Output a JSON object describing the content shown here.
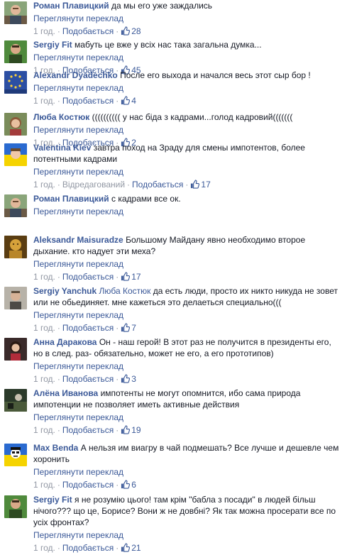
{
  "ui": {
    "translate_label": "Переглянути переклад",
    "like_label": "Подобається",
    "edited_label": "Відредагований",
    "separator": "·"
  },
  "comments": [
    {
      "author": "Роман Плавицкий",
      "text": "да мы его уже заждались",
      "time": "1 год.",
      "likes": "28",
      "avatar": "man-outdoor-photo"
    },
    {
      "author": "Sergiy Fit",
      "text": "мабуть це вже у всіх нас така загальна думка...",
      "time": "1 год.",
      "likes": "45",
      "avatar": "man-green-photo"
    },
    {
      "author": "Alexandr Dyadechko",
      "text": "После его выхода и начался весь этот сыр бор !",
      "time": "1 год.",
      "likes": "4",
      "avatar": "eu-flag-photo"
    },
    {
      "author": "Люба Костюк",
      "text": "(((((((((( у нас біда з кадрами...голод кадровий(((((((",
      "time": "1 год.",
      "likes": "2",
      "avatar": "woman-photo"
    },
    {
      "author": "Valentina Kiev",
      "text": "завтра поход на Зраду для смены импотентов, более потентными кадрами",
      "time": "1 год.",
      "edited": true,
      "likes": "17",
      "avatar": "ukraine-flag-face"
    },
    {
      "author": "Роман Плавицкий",
      "text": "с кадрами все ок.",
      "avatar": "man-outdoor-photo"
    },
    {
      "author": "Aleksandr Maisuradze",
      "text": "Большому Майдану явно необходимо второе дыхание. кто надует эти меха?",
      "time": "1 год.",
      "likes": "17",
      "avatar": "gold-figure-photo"
    },
    {
      "author": "Sergiy Yanchuk",
      "mention": "Люба Костюк",
      "text": "да есть люди, просто их никто никуда не зовет или не обьединяет. мне кажеться это делаеться специально(((",
      "time": "1 год.",
      "likes": "7",
      "avatar": "man-portrait-photo"
    },
    {
      "author": "Анна Даракова",
      "text": "Он - наш герой! В этот раз не получится в президенты его, но в след. раз- обязательно, может не его, а его прототипов)",
      "time": "1 год.",
      "likes": "3",
      "avatar": "woman-dark-photo"
    },
    {
      "author": "Алёна Иванова",
      "text": "импотенты не могут опомнится, ибо сама природа импотенции не позволяет иметь активные действия",
      "time": "1 год.",
      "likes": "19",
      "avatar": "dark-scene-photo"
    },
    {
      "author": "Max Benda",
      "text": "А нельзя им виагру в чай подмешать? Все лучше и дешевле чем хоронить",
      "time": "1 год.",
      "likes": "6",
      "avatar": "cartoon-flag-avatar"
    },
    {
      "author": "Sergiy Fit",
      "text": "я не розумію цього! там крім \"бабла з посади\" в людей більш нічого??? що це, Борисе? Вони ж не довбні? Як так можна просерати все по усіх фронтах?",
      "time": "1 год.",
      "likes": "21",
      "avatar": "man-green-photo"
    }
  ]
}
